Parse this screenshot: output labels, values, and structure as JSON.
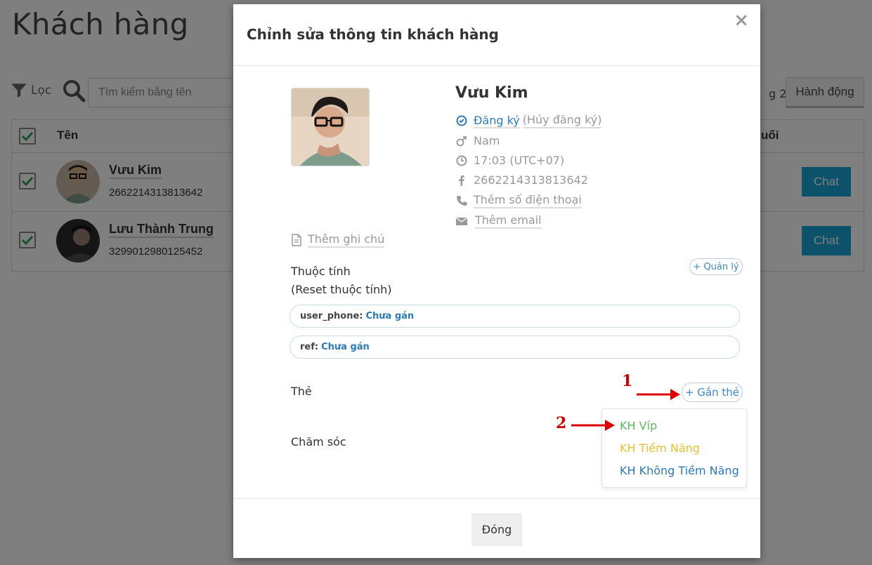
{
  "page": {
    "title": "Khách hàng",
    "filter_label": "Lọc",
    "search_placeholder": "Tìm kiếm bằng tên",
    "page_count": "g 2",
    "action_label": "Hành động",
    "table": {
      "col_name": "Tên",
      "col_last": "uối",
      "rows": [
        {
          "name": "Vưu Kim",
          "id": "2662214313813642",
          "chat_label": "Chat"
        },
        {
          "name": "Lưu Thành Trung",
          "id": "3299012980125452",
          "chat_label": "Chat"
        }
      ]
    }
  },
  "modal": {
    "title": "Chỉnh sửa thông tin khách hàng",
    "close_symbol": "×",
    "profile": {
      "name": "Vưu Kim",
      "subscribed": "Đăng ký",
      "unsubscribe": "(Hủy đăng ký)",
      "gender": "Nam",
      "time": "17:03 (UTC+07)",
      "facebook_id": "2662214313813642",
      "add_phone": "Thêm số điện thoại",
      "add_email": "Thêm email"
    },
    "add_note": "Thêm ghi chú",
    "attributes": {
      "title": "Thuộc tính",
      "reset": "(Reset thuộc tính)",
      "manage_label": "+ Quản lý",
      "items": [
        {
          "key": "user_phone:",
          "value": "Chưa gán"
        },
        {
          "key": "ref:",
          "value": "Chưa gán"
        }
      ]
    },
    "tags": {
      "label": "Thẻ",
      "add_label": "+ Gắn thẻ",
      "options": [
        {
          "label": "KH Víp",
          "color": "#5cb85c"
        },
        {
          "label": "KH Tiềm Năng",
          "color": "#e8c12a"
        },
        {
          "label": "KH Không Tiềm Năng",
          "color": "#2a7ab8"
        }
      ]
    },
    "care_label": "Chăm sóc",
    "annotations": {
      "one": "1",
      "two": "2"
    },
    "footer_close": "Đóng"
  },
  "colors": {
    "accent": "#1aa5d6",
    "link": "#2a7ab8",
    "annotation": "#cc0000",
    "check": "#2e9e5e"
  }
}
